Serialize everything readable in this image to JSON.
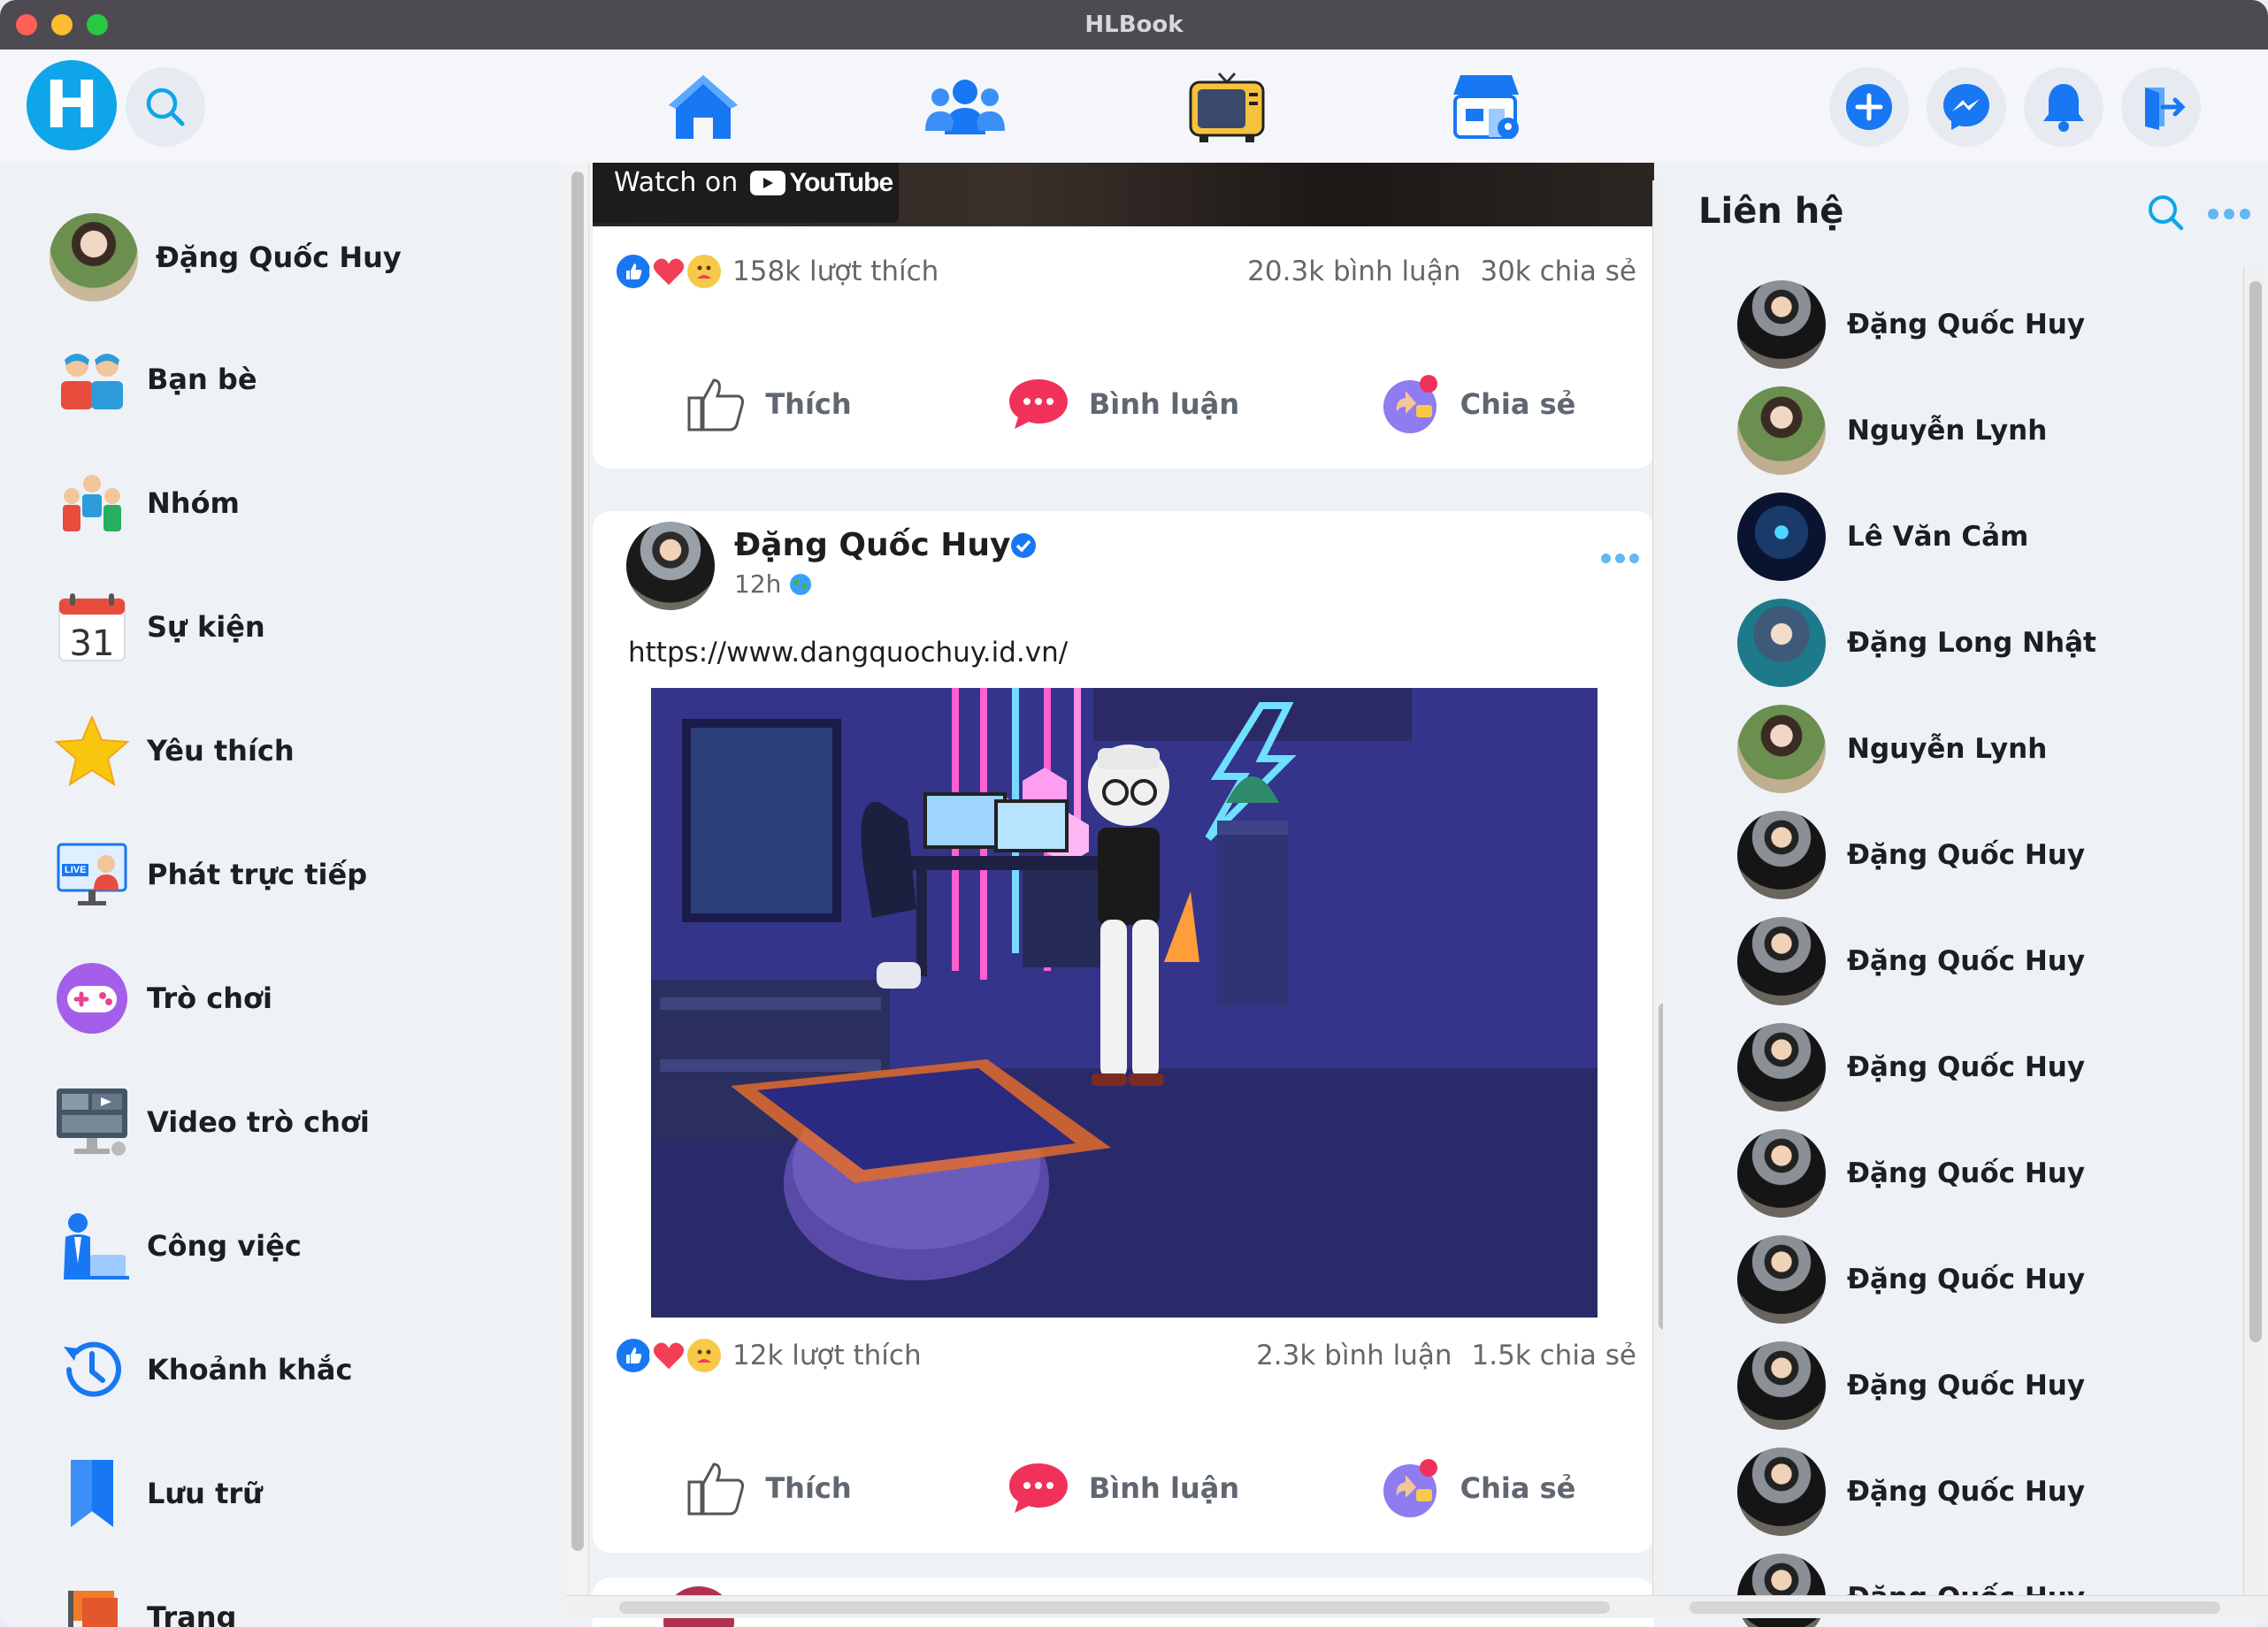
{
  "window": {
    "title": "HLBook"
  },
  "header": {
    "logo_letter": "H",
    "nav": [
      "home-icon",
      "friends-icon",
      "watch-icon",
      "marketplace-icon"
    ],
    "actions": [
      "add-icon",
      "messenger-icon",
      "notifications-icon",
      "logout-icon"
    ]
  },
  "sidebar": {
    "profile_name": "Đặng Quốc Huy",
    "items": [
      {
        "label": "Bạn bè",
        "icon": "friends-icon"
      },
      {
        "label": "Nhóm",
        "icon": "group-icon"
      },
      {
        "label": "Sự kiện",
        "icon": "calendar-icon",
        "calendar_day": "31"
      },
      {
        "label": "Yêu thích",
        "icon": "star-icon"
      },
      {
        "label": "Phát trực tiếp",
        "icon": "live-icon",
        "badge": "LIVE"
      },
      {
        "label": "Trò chơi",
        "icon": "gamepad-icon"
      },
      {
        "label": "Video trò chơi",
        "icon": "gaming-video-icon"
      },
      {
        "label": "Công việc",
        "icon": "work-icon"
      },
      {
        "label": "Khoảnh khắc",
        "icon": "memories-icon"
      },
      {
        "label": "Lưu trữ",
        "icon": "bookmark-icon"
      },
      {
        "label": "Trang",
        "icon": "pages-icon"
      }
    ]
  },
  "feed": {
    "video_overlay": {
      "watch_on": "Watch on",
      "brand": "YouTube"
    },
    "post1": {
      "likes": "158k lượt thích",
      "comments": "20.3k bình luận",
      "shares": "30k chia sẻ"
    },
    "post2": {
      "author": "Đặng Quốc Huy",
      "time": "12h",
      "text": "https://www.dangquochuy.id.vn/",
      "likes": "12k lượt thích",
      "comments": "2.3k bình luận",
      "shares": "1.5k chia sẻ"
    },
    "actions": {
      "like": "Thích",
      "comment": "Bình luận",
      "share": "Chia sẻ"
    }
  },
  "contacts": {
    "title": "Liên hệ",
    "list": [
      "Đặng Quốc Huy",
      "Nguyễn Lynh",
      "Lê Văn Cảm",
      "Đặng Long Nhật",
      "Nguyễn Lynh",
      "Đặng Quốc Huy",
      "Đặng Quốc Huy",
      "Đặng Quốc Huy",
      "Đặng Quốc Huy",
      "Đặng Quốc Huy",
      "Đặng Quốc Huy",
      "Đặng Quốc Huy",
      "Đặng Quốc Huy"
    ]
  },
  "colors": {
    "accent": "#1877f2",
    "logo": "#0ea5e9",
    "titlebar": "#4d4a52"
  }
}
